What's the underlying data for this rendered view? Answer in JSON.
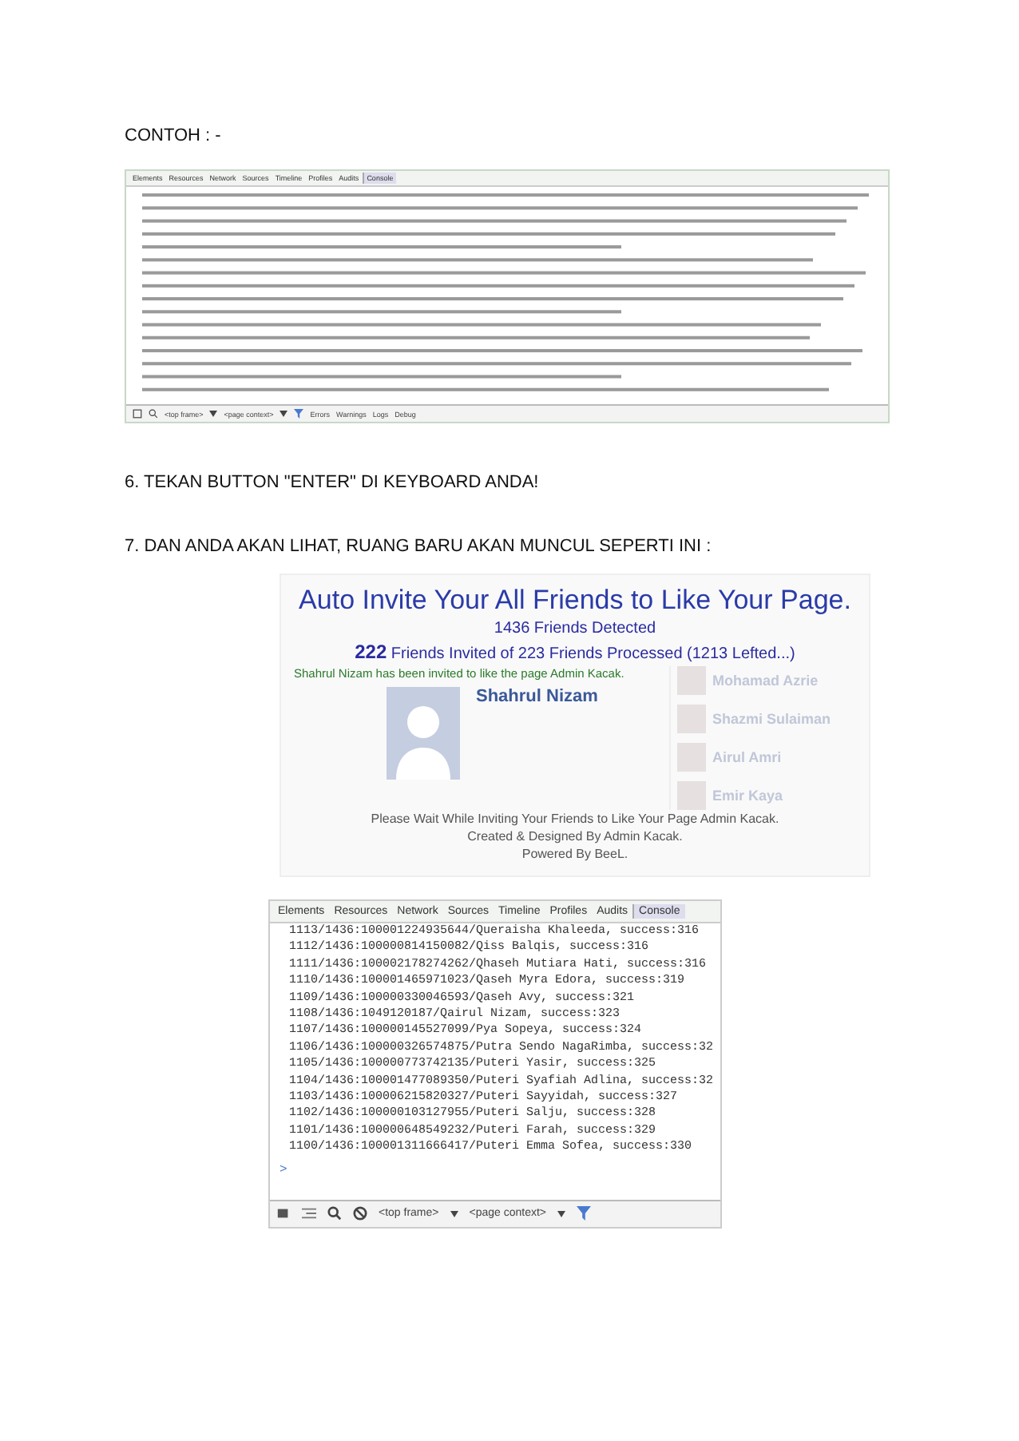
{
  "heading": "CONTOH : -",
  "devtools_top": {
    "tabs": [
      {
        "label": "Elements",
        "selected": false
      },
      {
        "label": "Resources",
        "selected": false
      },
      {
        "label": "Network",
        "selected": false
      },
      {
        "label": "Sources",
        "selected": false
      },
      {
        "label": "Timeline",
        "selected": false
      },
      {
        "label": "Profiles",
        "selected": false
      },
      {
        "label": "Audits",
        "selected": false
      },
      {
        "label": "Console",
        "selected": true
      }
    ],
    "frame": "<top frame>",
    "context": "<page context>",
    "filters": [
      "Errors",
      "Warnings",
      "Logs",
      "Debug"
    ]
  },
  "step_6": "6. TEKAN BUTTON \"ENTER\" DI KEYBOARD ANDA!",
  "step_7": "7. DAN ANDA AKAN LIHAT, RUANG BARU AKAN MUNCUL SEPERTI INI :",
  "invite_popup": {
    "title": "Auto Invite Your All Friends to Like Your Page.",
    "detected": "1436 Friends Detected",
    "progress": "**222** Friends Invited of 223 Friends Processed (1213 Lefted...)",
    "notice": "Shahrul Nizam has been invited to like the page Admin Kacak.",
    "friend_name": "Shahrul Nizam",
    "footer": [
      "Please Wait While Inviting Your Friends to Like Your Page Admin Kacak.",
      "Created & Designed By Admin Kacak.",
      "Powered By BeeL."
    ],
    "background_friends": [
      "Mohamad Azrie",
      "Shazmi Sulaiman",
      "Airul Amri",
      "Emir Kaya"
    ]
  },
  "devtools_bottom": {
    "tabs": [
      {
        "label": "Elements",
        "selected": false
      },
      {
        "label": "Resources",
        "selected": false
      },
      {
        "label": "Network",
        "selected": false
      },
      {
        "label": "Sources",
        "selected": false
      },
      {
        "label": "Timeline",
        "selected": false
      },
      {
        "label": "Profiles",
        "selected": false
      },
      {
        "label": "Audits",
        "selected": false
      },
      {
        "label": "Console",
        "selected": true
      }
    ],
    "log_lines": [
      "1113/1436:100001224935644/Queraisha Khaleeda, success:316",
      "1112/1436:100000814150082/Qiss Balqis, success:316",
      "1111/1436:100002178274262/Qhaseh Mutiara Hati, success:316",
      "1110/1436:100001465971023/Qaseh Myra Edora, success:319",
      "1109/1436:100000330046593/Qaseh Avy, success:321",
      "1108/1436:1049120187/Qairul Nizam, success:323",
      "1107/1436:100000145527099/Pya Sopeya, success:324",
      "1106/1436:100000326574875/Putra Sendo NagaRimba, success:32",
      "1105/1436:100000773742135/Puteri Yasir, success:325",
      "1104/1436:100001477089350/Puteri Syafiah Adlina, success:32",
      "1103/1436:100006215820327/Puteri Sayyidah, success:327",
      "1102/1436:100000103127955/Puteri Salju, success:328",
      "1101/1436:100000648549232/Puteri Farah, success:329",
      "1100/1436:100001311666417/Puteri Emma Sofea, success:330"
    ],
    "prompt": ">",
    "frame": "<top frame>",
    "context": "<page context>"
  }
}
